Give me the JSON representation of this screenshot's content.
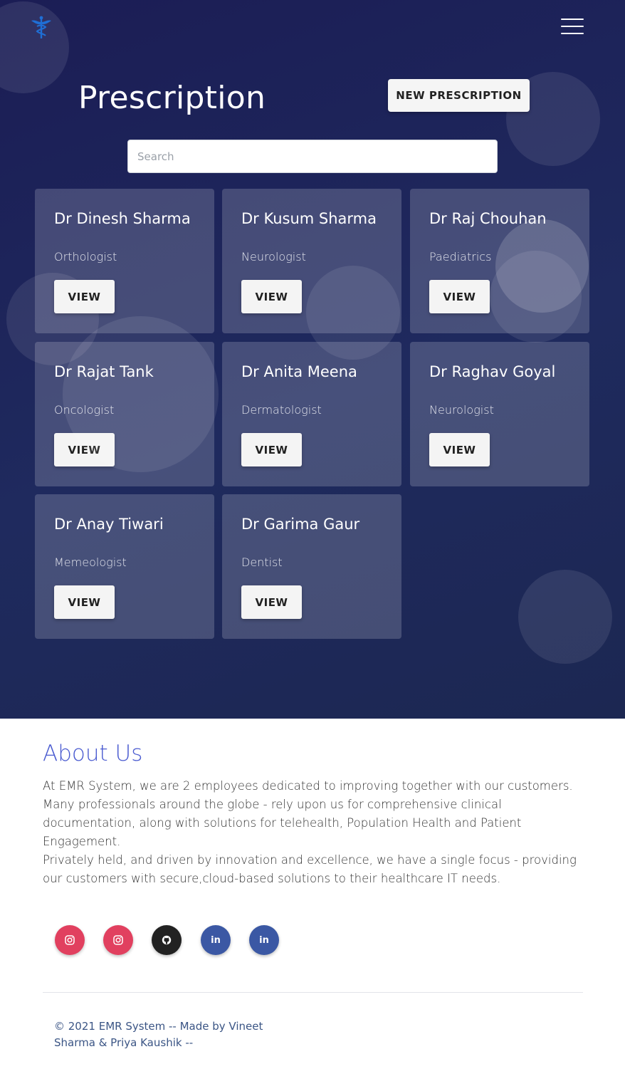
{
  "header": {
    "logo_icon": "caduceus-icon",
    "menu_icon": "hamburger-menu-icon"
  },
  "main": {
    "title": "Prescription",
    "new_button_label": "NEW PRESCRIPTION",
    "search": {
      "placeholder": "Search",
      "value": ""
    },
    "doctors": [
      {
        "name": "Dr Dinesh Sharma",
        "specialty": "Orthologist",
        "action": "VIEW"
      },
      {
        "name": "Dr Kusum Sharma",
        "specialty": "Neurologist",
        "action": "VIEW"
      },
      {
        "name": "Dr Raj Chouhan",
        "specialty": "Paediatrics",
        "action": "VIEW"
      },
      {
        "name": "Dr Rajat Tank",
        "specialty": "Oncologist",
        "action": "VIEW"
      },
      {
        "name": "Dr Anita Meena",
        "specialty": "Dermatologist",
        "action": "VIEW"
      },
      {
        "name": "Dr Raghav Goyal",
        "specialty": "Neurologist",
        "action": "VIEW"
      },
      {
        "name": "Dr Anay Tiwari",
        "specialty": "Memeologist",
        "action": "VIEW"
      },
      {
        "name": "Dr Garima Gaur",
        "specialty": "Dentist",
        "action": "VIEW"
      }
    ]
  },
  "about": {
    "title": "About Us",
    "paragraphs": [
      "At EMR System, we are 2 employees dedicated to improving together with our customers. Many professionals around the globe - rely upon us for comprehensive clinical documentation, along with solutions for telehealth, Population Health and Patient Engagement.",
      "Privately held, and driven by innovation and excellence, we have a single focus - providing our customers with secure,cloud-based solutions to their healthcare IT needs."
    ]
  },
  "social": [
    {
      "icon": "instagram-icon",
      "color": "#e1405f"
    },
    {
      "icon": "instagram-icon",
      "color": "#e1405f"
    },
    {
      "icon": "github-icon",
      "color": "#222222"
    },
    {
      "icon": "linkedin-icon",
      "label": "in",
      "color": "#3b58a4"
    },
    {
      "icon": "linkedin-icon",
      "label": "in",
      "color": "#3b58a4"
    }
  ],
  "footer": {
    "copyright": "© 2021 EMR System -- Made by Vineet Sharma & Priya Kaushik --"
  },
  "colors": {
    "hero_bg": "#1b1d55",
    "about_title": "#4a5bd0",
    "footer_text": "#3b5585"
  }
}
